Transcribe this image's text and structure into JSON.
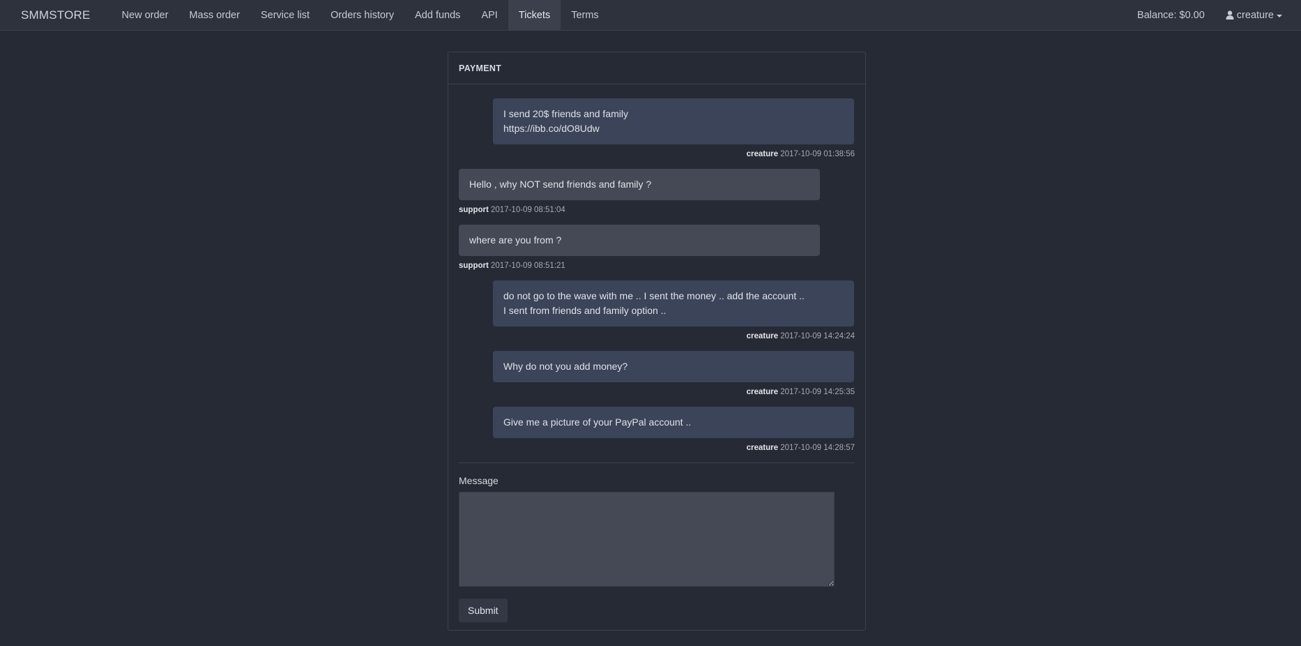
{
  "nav": {
    "brand": "SMMSTORE",
    "items": [
      {
        "label": "New order"
      },
      {
        "label": "Mass order"
      },
      {
        "label": "Service list"
      },
      {
        "label": "Orders history"
      },
      {
        "label": "Add funds"
      },
      {
        "label": "API"
      },
      {
        "label": "Tickets",
        "active": true
      },
      {
        "label": "Terms"
      }
    ],
    "balance": "Balance: $0.00",
    "user": "creature"
  },
  "ticket": {
    "title": "PAYMENT",
    "messages": [
      {
        "role": "user",
        "lines": [
          "I send 20$ friends and family",
          "https://ibb.co/dO8Udw"
        ],
        "author": "creature",
        "time": "2017-10-09 01:38:56"
      },
      {
        "role": "support",
        "lines": [
          "Hello , why NOT send friends and family ?"
        ],
        "author": "support",
        "time": "2017-10-09 08:51:04"
      },
      {
        "role": "support",
        "lines": [
          "where are you from ?"
        ],
        "author": "support",
        "time": "2017-10-09 08:51:21"
      },
      {
        "role": "user",
        "lines": [
          "do not go to the wave with me .. I sent the money .. add the account ..",
          "I sent from friends and family option .."
        ],
        "author": "creature",
        "time": "2017-10-09 14:24:24"
      },
      {
        "role": "user",
        "lines": [
          "Why do not you add money?"
        ],
        "author": "creature",
        "time": "2017-10-09 14:25:35"
      },
      {
        "role": "user",
        "lines": [
          "Give me a picture of your PayPal account .."
        ],
        "author": "creature",
        "time": "2017-10-09 14:28:57"
      }
    ]
  },
  "form": {
    "message_label": "Message",
    "message_value": "",
    "submit_label": "Submit"
  },
  "colors": {
    "background": "#262a35",
    "navbar": "#2e323d",
    "user_bubble": "#3c4459",
    "support_bubble": "#454955"
  }
}
